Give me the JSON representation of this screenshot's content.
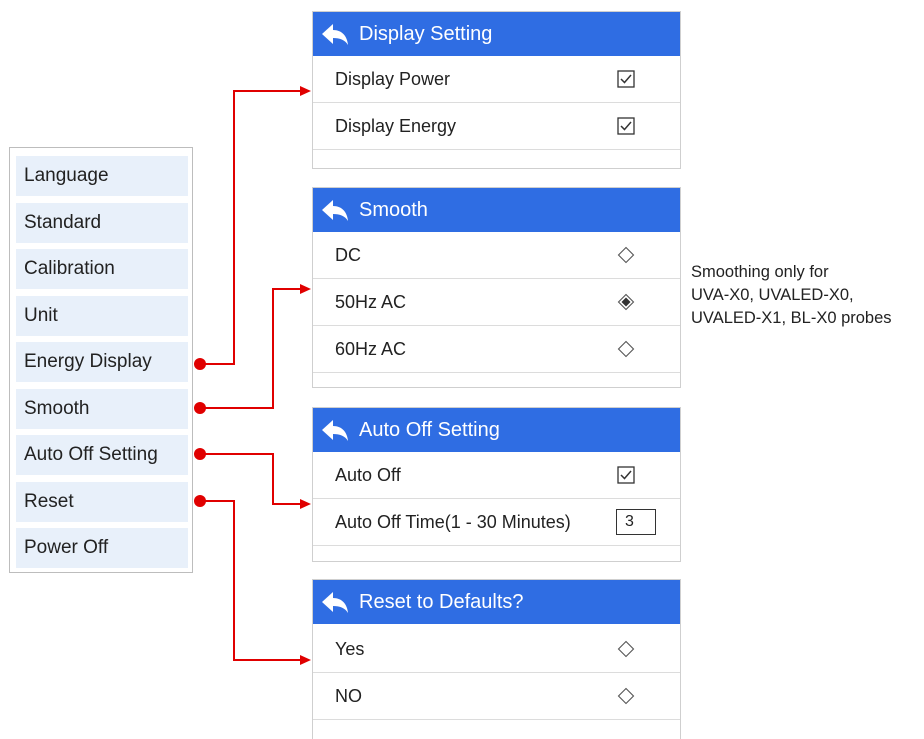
{
  "menu": {
    "items": [
      {
        "label": "Language"
      },
      {
        "label": "Standard"
      },
      {
        "label": "Calibration"
      },
      {
        "label": "Unit"
      },
      {
        "label": "Energy Display"
      },
      {
        "label": "Smooth"
      },
      {
        "label": "Auto Off Setting"
      },
      {
        "label": "Reset"
      },
      {
        "label": "Power Off"
      }
    ]
  },
  "display_setting": {
    "title": "Display Setting",
    "rows": [
      {
        "label": "Display Power",
        "control": "checkbox",
        "checked": true
      },
      {
        "label": "Display Energy",
        "control": "checkbox",
        "checked": true
      }
    ]
  },
  "smooth": {
    "title": "Smooth",
    "rows": [
      {
        "label": "DC",
        "control": "radio",
        "selected": false
      },
      {
        "label": "50Hz AC",
        "control": "radio",
        "selected": true
      },
      {
        "label": "60Hz AC",
        "control": "radio",
        "selected": false
      }
    ]
  },
  "auto_off": {
    "title": "Auto Off Setting",
    "rows": [
      {
        "label": "Auto Off",
        "control": "checkbox",
        "checked": true
      },
      {
        "label": "Auto Off Time(1 - 30 Minutes)",
        "control": "number",
        "value": "3"
      }
    ]
  },
  "reset": {
    "title": "Reset to Defaults?",
    "rows": [
      {
        "label": "Yes",
        "control": "radio",
        "selected": false
      },
      {
        "label": "NO",
        "control": "radio",
        "selected": false
      }
    ]
  },
  "note": {
    "lines": [
      "Smoothing only for",
      "UVA-X0, UVALED-X0,",
      "UVALED-X1, BL-X0 probes"
    ]
  },
  "colors": {
    "header_blue": "#2f6de3",
    "menu_item_bg": "#e8f0fa",
    "connector_red": "#e00000"
  },
  "icons": {
    "back": "back-arrow-icon",
    "checkbox": "checkbox-checked-icon",
    "radio_on": "radio-selected-diamond-icon",
    "radio_off": "radio-empty-diamond-icon"
  }
}
